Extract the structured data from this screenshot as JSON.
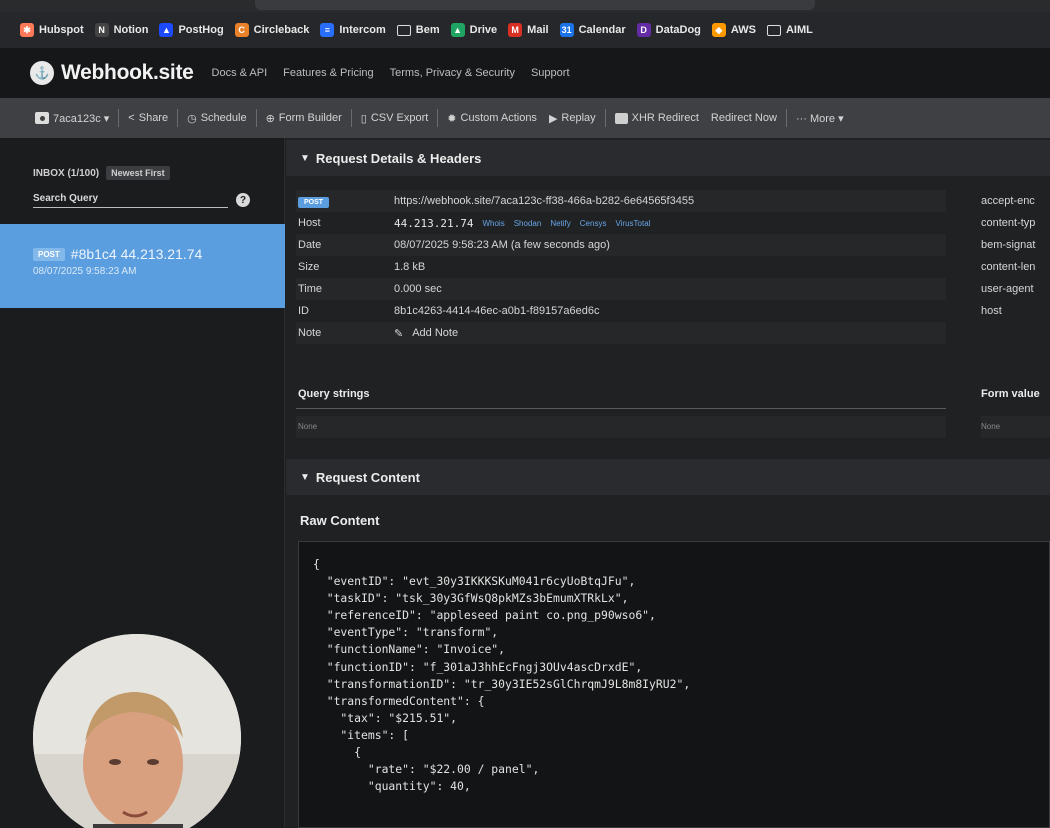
{
  "bookmarks": [
    {
      "label": "Hubspot",
      "icon": "hubspot-icon",
      "color": "#ff7a59",
      "glyph": "✱"
    },
    {
      "label": "Notion",
      "icon": "notion-icon",
      "color": "#444444",
      "glyph": "N"
    },
    {
      "label": "PostHog",
      "icon": "posthog-icon",
      "color": "#1d4aff",
      "glyph": "▲"
    },
    {
      "label": "Circleback",
      "icon": "circleback-icon",
      "color": "#e8812a",
      "glyph": "C"
    },
    {
      "label": "Intercom",
      "icon": "intercom-icon",
      "color": "#286efa",
      "glyph": "≡"
    },
    {
      "label": "Bem",
      "icon": "folder-icon",
      "color": "",
      "glyph": ""
    },
    {
      "label": "Drive",
      "icon": "drive-icon",
      "color": "#1fa463",
      "glyph": "▲"
    },
    {
      "label": "Mail",
      "icon": "gmail-icon",
      "color": "#d93025",
      "glyph": "M"
    },
    {
      "label": "Calendar",
      "icon": "calendar-icon",
      "color": "#1a73e8",
      "glyph": "31"
    },
    {
      "label": "DataDog",
      "icon": "datadog-icon",
      "color": "#632ca6",
      "glyph": "D"
    },
    {
      "label": "AWS",
      "icon": "aws-icon",
      "color": "#ff9900",
      "glyph": "◆"
    },
    {
      "label": "AIML",
      "icon": "folder-icon",
      "color": "",
      "glyph": ""
    }
  ],
  "site": {
    "logo_text": "Webhook.site",
    "nav": [
      "Docs & API",
      "Features & Pricing",
      "Terms, Privacy & Security",
      "Support"
    ]
  },
  "toolbar": {
    "token": "7aca123c ▾",
    "share": "Share",
    "schedule": "Schedule",
    "form_builder": "Form Builder",
    "csv_export": "CSV Export",
    "custom_actions": "Custom Actions",
    "replay": "Replay",
    "xhr_redirect": "XHR Redirect",
    "redirect_now": "Redirect Now",
    "more": "··· More ▾"
  },
  "sidebar": {
    "inbox_count": "INBOX (1/100)",
    "sort": "Newest First",
    "search_placeholder": "Search Query",
    "help": "?",
    "request": {
      "method": "POST",
      "id_ip": "#8b1c4 44.213.21.74",
      "time": "08/07/2025 9:58:23 AM"
    }
  },
  "main": {
    "details_title": "Request Details & Headers",
    "method": "POST",
    "url": "https://webhook.site/7aca123c-ff38-466a-b282-6e64565f3455",
    "rows": {
      "host_label": "Host",
      "host_value": "44.213.21.74",
      "host_links": [
        "Whois",
        "Shodan",
        "Netify",
        "Censys",
        "VirusTotal"
      ],
      "date_label": "Date",
      "date_value": "08/07/2025 9:58:23 AM (a few seconds ago)",
      "size_label": "Size",
      "size_value": "1.8 kB",
      "time_label": "Time",
      "time_value": "0.000 sec",
      "id_label": "ID",
      "id_value": "8b1c4263-4414-46ec-a0b1-f89157a6ed6c",
      "note_label": "Note",
      "note_value": "Add Note"
    },
    "headers": [
      "accept-enc",
      "content-typ",
      "bem-signat",
      "content-len",
      "user-agent",
      "host"
    ],
    "query_strings_title": "Query strings",
    "query_strings_value": "None",
    "form_values_title": "Form value",
    "form_values_value": "None",
    "content_title": "Request Content",
    "raw_title": "Raw Content",
    "raw_content": "{\n  \"eventID\": \"evt_30y3IKKKSKuM041r6cyUoBtqJFu\",\n  \"taskID\": \"tsk_30y3GfWsQ8pkMZs3bEmumXTRkLx\",\n  \"referenceID\": \"appleseed paint co.png_p90wso6\",\n  \"eventType\": \"transform\",\n  \"functionName\": \"Invoice\",\n  \"functionID\": \"f_301aJ3hhEcFngj3OUv4ascDrxdE\",\n  \"transformationID\": \"tr_30y3IE52sGlChrqmJ9L8m8IyRU2\",\n  \"transformedContent\": {\n    \"tax\": \"$215.51\",\n    \"items\": [\n      {\n        \"rate\": \"$22.00 / panel\",\n        \"quantity\": 40,"
  }
}
